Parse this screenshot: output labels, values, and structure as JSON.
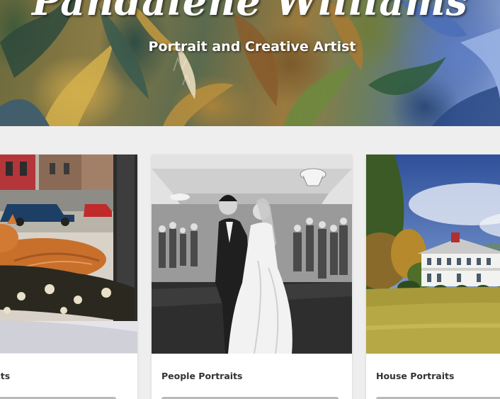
{
  "hero": {
    "title": "Pandalene Williams",
    "subtitle": "Portrait and Creative Artist"
  },
  "gallery": {
    "cards": [
      {
        "title": "Pet Portraits",
        "image": "cat on pillows painting"
      },
      {
        "title": "People Portraits",
        "image": "wedding first dance painting"
      },
      {
        "title": "House Portraits",
        "image": "white plantation house painting"
      }
    ]
  },
  "colors": {
    "background": "#eeeeee",
    "card": "#ffffff",
    "title_text": "#333333",
    "hero_text": "#ffffff"
  }
}
